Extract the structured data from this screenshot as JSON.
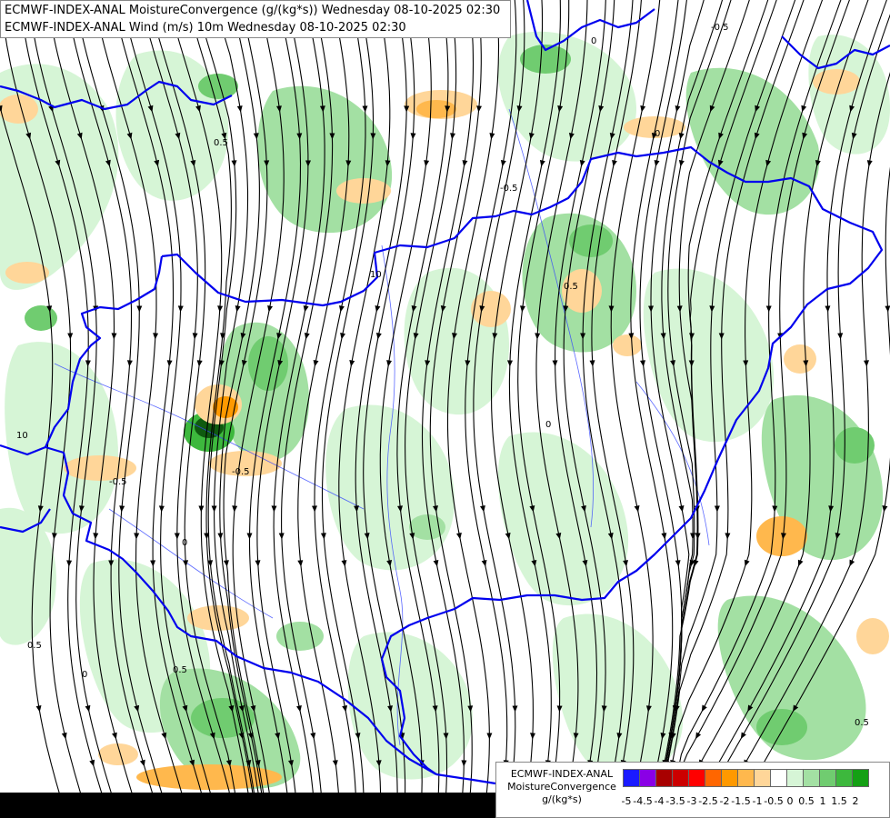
{
  "header": {
    "line1": "ECMWF-INDEX-ANAL MoistureConvergence (g/(kg*s)) Wednesday 08-10-2025 02:30",
    "line2": "ECMWF-INDEX-ANAL Wind (m/s) 10m Wednesday 08-10-2025 02:30"
  },
  "legend": {
    "model": "ECMWF-INDEX-ANAL",
    "variable": "MoistureConvergence",
    "unit": "g/(kg*s)",
    "colors": [
      "#1a1aff",
      "#8a00e6",
      "#a80000",
      "#cc0000",
      "#ff0000",
      "#ff6600",
      "#ff9900",
      "#ffb84d",
      "#ffd699",
      "#ffffff",
      "#d6f5d6",
      "#a3e0a3",
      "#70cc70",
      "#3db83d",
      "#14a014"
    ],
    "tick_labels": [
      "-5",
      "-4.5",
      "-4",
      "-3.5",
      "-3",
      "-2.5",
      "-2",
      "-1.5",
      "-1",
      "-0.5",
      "0",
      "0.5",
      "1",
      "1.5",
      "2"
    ]
  },
  "map_labels": {
    "contour_labels": [
      "-0.5",
      "0",
      "0.5",
      "10",
      "-0.5",
      "0.5",
      "0",
      "-0.5",
      "0.5",
      "0",
      "10",
      "0.5",
      "0",
      "-0.5",
      "0.5",
      "0"
    ]
  },
  "colors": {
    "border": "#0000ee",
    "river": "#3344ff",
    "streamline": "#000000",
    "green_light": "#d6f5d6",
    "green_mid": "#a3e0a3",
    "green_strong": "#70cc70",
    "green_dark": "#3db83d",
    "orange_light": "#ffd699",
    "orange_mid": "#ffb84d",
    "orange_strong": "#ff9900"
  }
}
